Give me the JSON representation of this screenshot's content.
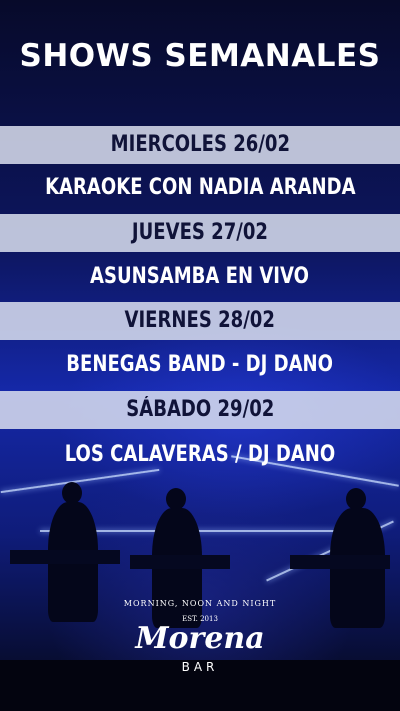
{
  "title": "SHOWS SEMANALES",
  "schedule": [
    {
      "day": "MIERCOLES 26/02",
      "show": "KARAOKE CON NADIA ARANDA"
    },
    {
      "day": "JUEVES 27/02",
      "show": "ASUNSAMBA EN VIVO"
    },
    {
      "day": "VIERNES 28/02",
      "show": "BENEGAS BAND - DJ DANO"
    },
    {
      "day": "SÁBADO 29/02",
      "show": "LOS CALAVERAS / DJ DANO"
    }
  ],
  "logo": {
    "tagline": "MORNING, NOON AND NIGHT",
    "est": "EST. 2013",
    "name": "Morena",
    "sub": "BAR"
  },
  "colors": {
    "band": "#dce0f0",
    "text_dark": "#101338",
    "background": "#1528a8"
  }
}
